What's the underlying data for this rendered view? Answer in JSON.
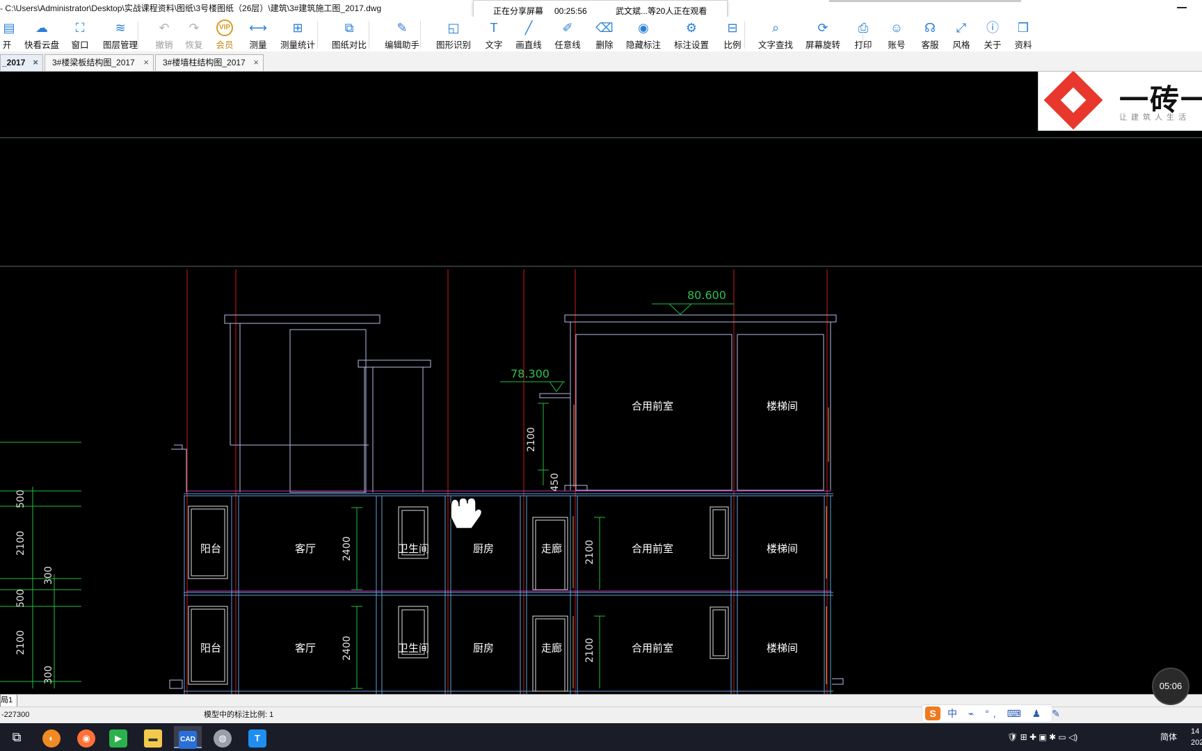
{
  "window": {
    "title": "- C:\\Users\\Administrator\\Desktop\\实战课程资料\\图纸\\3号楼图纸（26层）\\建筑\\3#建筑施工图_2017.dwg"
  },
  "share": {
    "status": "正在分享屏幕",
    "elapsed": "00:25:56",
    "viewers": "武文斌...等20人正在观看"
  },
  "toolbar": {
    "items": [
      {
        "label": "开",
        "icon": "open-icon",
        "glyph": "▤"
      },
      {
        "label": "快看云盘",
        "icon": "cloud-icon",
        "glyph": "☁"
      },
      {
        "label": "窗口",
        "icon": "window-icon",
        "glyph": "⛶"
      },
      {
        "label": "图层管理",
        "icon": "layers-icon",
        "glyph": "≋"
      },
      {
        "label": "撤销",
        "icon": "undo-icon",
        "glyph": "↶"
      },
      {
        "label": "恢复",
        "icon": "redo-icon",
        "glyph": "↷"
      },
      {
        "label": "会员",
        "icon": "vip-icon",
        "glyph": "VIP"
      },
      {
        "label": "测量",
        "icon": "measure-icon",
        "glyph": "⟷"
      },
      {
        "label": "测量统计",
        "icon": "measure-stats-icon",
        "glyph": "⊞"
      },
      {
        "label": "图纸对比",
        "icon": "compare-icon",
        "glyph": "⧉"
      },
      {
        "label": "编辑助手",
        "icon": "edit-helper-icon",
        "glyph": "✎"
      },
      {
        "label": "图形识别",
        "icon": "shape-recognize-icon",
        "glyph": "◱"
      },
      {
        "label": "文字",
        "icon": "text-icon",
        "glyph": "T"
      },
      {
        "label": "画直线",
        "icon": "line-icon",
        "glyph": "╱"
      },
      {
        "label": "任意线",
        "icon": "freehand-icon",
        "glyph": "✐"
      },
      {
        "label": "删除",
        "icon": "eraser-icon",
        "glyph": "⌫"
      },
      {
        "label": "隐藏标注",
        "icon": "hide-annotation-icon",
        "glyph": "◉"
      },
      {
        "label": "标注设置",
        "icon": "annotation-settings-icon",
        "glyph": "⚙"
      },
      {
        "label": "比例",
        "icon": "scale-icon",
        "glyph": "⊟"
      },
      {
        "label": "文字查找",
        "icon": "text-search-icon",
        "glyph": "⌕"
      },
      {
        "label": "屏幕旋转",
        "icon": "rotate-icon",
        "glyph": "⟳"
      },
      {
        "label": "打印",
        "icon": "print-icon",
        "glyph": "⎙"
      },
      {
        "label": "账号",
        "icon": "account-icon",
        "glyph": "☺"
      },
      {
        "label": "客服",
        "icon": "headset-icon",
        "glyph": "☊"
      },
      {
        "label": "风格",
        "icon": "style-icon",
        "glyph": "⤢"
      },
      {
        "label": "关于",
        "icon": "info-icon",
        "glyph": "ⓘ"
      },
      {
        "label": "资料",
        "icon": "docs-icon",
        "glyph": "❒"
      }
    ]
  },
  "tabs": [
    {
      "label": "_2017",
      "active": true
    },
    {
      "label": "3#楼梁板结构图_2017",
      "active": false
    },
    {
      "label": "3#楼墙柱结构图_2017",
      "active": false
    }
  ],
  "logo": {
    "brand": "一砖一",
    "slogan": "让建筑人生活"
  },
  "drawing": {
    "elev_top": "80.600",
    "elev_mid": "78.300",
    "dim_2100_upper": "2100",
    "dim_450": "450",
    "rooms_top": [
      "合用前室",
      "楼梯间"
    ],
    "rooms_floor": [
      "阳台",
      "客厅",
      "卫生间",
      "厨房",
      "走廊",
      "合用前室",
      "楼梯间"
    ],
    "dim_2400": "2400",
    "dim_2100": "2100",
    "left_dims": [
      "500",
      "2100",
      "300",
      "500",
      "2100",
      "300"
    ]
  },
  "layout_tab": "局1",
  "status": {
    "coords": "-227300",
    "scale": "模型中的标注比例: 1"
  },
  "ime": {
    "chars": "中 ⌁ °, ⌨ ♟ ✎"
  },
  "clock_bubble": "05:06",
  "tray": {
    "lang": "简体",
    "time": "14",
    "date": "202"
  }
}
